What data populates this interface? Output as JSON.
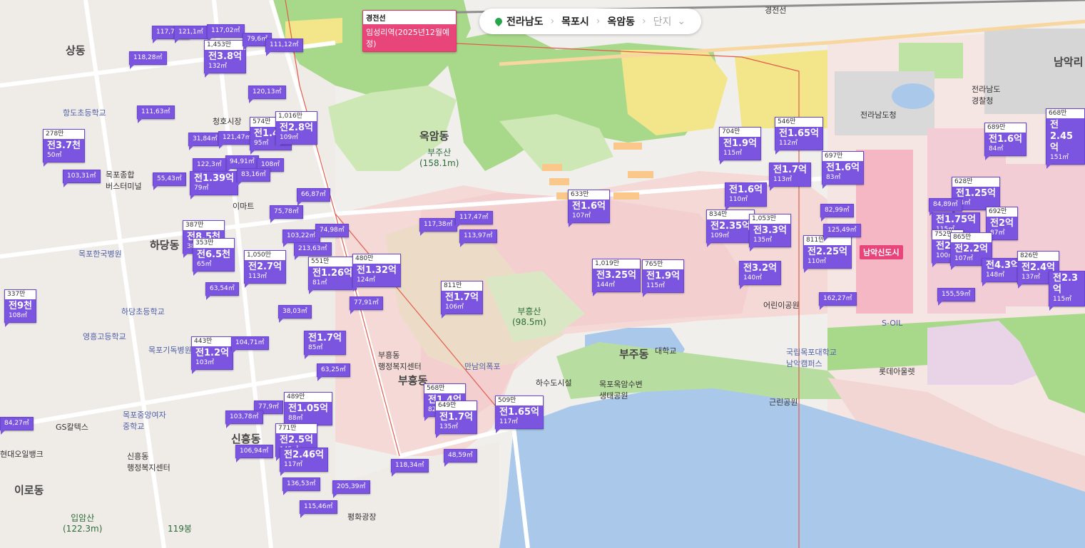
{
  "breadcrumb": {
    "province": "전라남도",
    "city": "목포시",
    "district": "옥암동",
    "level": "단지"
  },
  "station_tag": {
    "line": "경전선",
    "name": "임성리역(2025년12월예정)"
  },
  "new_town_pin": "남악신도시",
  "map_labels": [
    {
      "id": "sangdong",
      "text": "상동",
      "cls": "big"
    },
    {
      "id": "hadangdong",
      "text": "하당동",
      "cls": "big"
    },
    {
      "id": "okamdong",
      "text": "옥암동",
      "cls": "big"
    },
    {
      "id": "bujudong",
      "text": "부주동",
      "cls": "big"
    },
    {
      "id": "sinheungdong",
      "text": "신흥동",
      "cls": "big"
    },
    {
      "id": "irodong",
      "text": "이로동",
      "cls": "big"
    },
    {
      "id": "namak",
      "text": "남악리",
      "cls": "big"
    },
    {
      "id": "bubheungdong",
      "text": "부흥동",
      "cls": "big"
    },
    {
      "id": "busan",
      "text": "부주산\n(158.1m)",
      "cls": "mtn"
    },
    {
      "id": "buheungsan",
      "text": "부흥산\n(98.5m)",
      "cls": "mtn"
    },
    {
      "id": "ipamsan",
      "text": "입암산\n(122.3m)",
      "cls": "mtn"
    },
    {
      "id": "bong119",
      "text": "119봉",
      "cls": "mtn"
    },
    {
      "id": "hangdo",
      "text": "항도초등학교",
      "cls": "poi"
    },
    {
      "id": "hadang_school",
      "text": "하당초등학교",
      "cls": "poi"
    },
    {
      "id": "yeongheung",
      "text": "영흥고등학교",
      "cls": "poi"
    },
    {
      "id": "mokpo_jungang",
      "text": "목포중앙여자\n중학교",
      "cls": "poi"
    },
    {
      "id": "mokpo_hospital",
      "text": "목포한국병원",
      "cls": "poi"
    },
    {
      "id": "mokpo_christian",
      "text": "목포기독병원",
      "cls": "poi"
    },
    {
      "id": "terminal",
      "text": "목포종합\n버스터미널",
      "cls": "zone"
    },
    {
      "id": "cheongho",
      "text": "청호시장",
      "cls": "zone"
    },
    {
      "id": "emart",
      "text": "이마트",
      "cls": "zone"
    },
    {
      "id": "gs",
      "text": "GS칼텍스",
      "cls": "zone"
    },
    {
      "id": "hyundai_oil",
      "text": "현대오일뱅크",
      "cls": "zone"
    },
    {
      "id": "sinheung_center",
      "text": "신흥동\n행정복지센터",
      "cls": "zone"
    },
    {
      "id": "buheung_center",
      "text": "부흥동\n행정복지센터",
      "cls": "zone"
    },
    {
      "id": "manin",
      "text": "만남의폭포",
      "cls": "poi"
    },
    {
      "id": "pyeonghwa",
      "text": "평화광장",
      "cls": "zone"
    },
    {
      "id": "eco_park",
      "text": "목포옥암수변\n생태공원",
      "cls": "zone"
    },
    {
      "id": "mokpo_univ",
      "text": "국립목포대학교\n남악캠퍼스",
      "cls": "poi"
    },
    {
      "id": "jeonnam_police",
      "text": "전라남도\n경찰청",
      "cls": "zone"
    },
    {
      "id": "jeonnam_office",
      "text": "전라남도청",
      "cls": "zone"
    },
    {
      "id": "lotte",
      "text": "롯데아울렛",
      "cls": "zone"
    },
    {
      "id": "soil",
      "text": "S-OIL",
      "cls": "poi"
    },
    {
      "id": "eorin_park",
      "text": "어린이공원",
      "cls": "zone"
    },
    {
      "id": "geunlin_park",
      "text": "근린공원",
      "cls": "zone"
    },
    {
      "id": "hasudo",
      "text": "하수도시설",
      "cls": "zone"
    },
    {
      "id": "daehakgyo",
      "text": "대학교",
      "cls": "zone"
    },
    {
      "id": "gyeongjeonseon",
      "text": "경전선",
      "cls": "zone"
    }
  ],
  "markers": [
    {
      "id": "m01",
      "top": "",
      "price": "",
      "area": "117,72㎡"
    },
    {
      "id": "m02",
      "top": "",
      "price": "",
      "area": "121,1㎡"
    },
    {
      "id": "m03",
      "top": "",
      "price": "",
      "area": "117,02㎡"
    },
    {
      "id": "m04",
      "top": "1,453만",
      "price": "전3.8억",
      "area": "132㎡"
    },
    {
      "id": "m05",
      "top": "",
      "price": "",
      "area": "79,6㎡"
    },
    {
      "id": "m06",
      "top": "",
      "price": "",
      "area": "111,12㎡"
    },
    {
      "id": "m07",
      "top": "",
      "price": "",
      "area": "118,28㎡"
    },
    {
      "id": "m08",
      "top": "",
      "price": "",
      "area": "120,13㎡"
    },
    {
      "id": "m09",
      "top": "",
      "price": "",
      "area": "111,63㎡"
    },
    {
      "id": "m10",
      "top": "278만",
      "price": "전3.7천",
      "area": "50㎡"
    },
    {
      "id": "m11",
      "top": "",
      "price": "",
      "area": "103,31㎡"
    },
    {
      "id": "m12",
      "top": "",
      "price": "",
      "area": "31,84㎡"
    },
    {
      "id": "m13",
      "top": "",
      "price": "",
      "area": "121,47㎡"
    },
    {
      "id": "m14",
      "top": "574만",
      "price": "전1.4억",
      "area": "95㎡"
    },
    {
      "id": "m15",
      "top": "1,016만",
      "price": "전2.8억",
      "area": "109㎡"
    },
    {
      "id": "m16",
      "top": "",
      "price": "",
      "area": "94,91㎡"
    },
    {
      "id": "m17",
      "top": "",
      "price": "",
      "area": "108㎡"
    },
    {
      "id": "m18",
      "top": "",
      "price": "",
      "area": "122,3㎡"
    },
    {
      "id": "m19",
      "top": "",
      "price": "전1.39억",
      "area": "79㎡"
    },
    {
      "id": "m20",
      "top": "",
      "price": "",
      "area": "83,16㎡"
    },
    {
      "id": "m21",
      "top": "",
      "price": "",
      "area": "55,43㎡"
    },
    {
      "id": "m22",
      "top": "",
      "price": "",
      "area": "66,87㎡"
    },
    {
      "id": "m23",
      "top": "",
      "price": "",
      "area": "75,78㎡"
    },
    {
      "id": "m24",
      "top": "387만",
      "price": "전8.5천",
      "area": "38㎡"
    },
    {
      "id": "m25",
      "top": "353만",
      "price": "전6.5천",
      "area": "65㎡"
    },
    {
      "id": "m26",
      "top": "",
      "price": "",
      "area": "103,22㎡"
    },
    {
      "id": "m27",
      "top": "",
      "price": "",
      "area": "74,98㎡"
    },
    {
      "id": "m28",
      "top": "",
      "price": "",
      "area": "213,63㎡"
    },
    {
      "id": "m29",
      "top": "",
      "price": "",
      "area": "117,38㎡"
    },
    {
      "id": "m30",
      "top": "",
      "price": "",
      "area": "117,47㎡"
    },
    {
      "id": "m31",
      "top": "",
      "price": "",
      "area": "113,97㎡"
    },
    {
      "id": "m32",
      "top": "1,050만",
      "price": "전2.7억",
      "area": "113㎡"
    },
    {
      "id": "m33",
      "top": "551만",
      "price": "전1.26억",
      "area": "81㎡"
    },
    {
      "id": "m34",
      "top": "480만",
      "price": "전1.32억",
      "area": "124㎡"
    },
    {
      "id": "m35",
      "top": "",
      "price": "",
      "area": "63,54㎡"
    },
    {
      "id": "m36",
      "top": "337만",
      "price": "전9천",
      "area": "108㎡"
    },
    {
      "id": "m37",
      "top": "",
      "price": "",
      "area": "38,03㎡"
    },
    {
      "id": "m38",
      "top": "",
      "price": "",
      "area": "77,91㎡"
    },
    {
      "id": "m39",
      "top": "811만",
      "price": "전1.7억",
      "area": "106㎡"
    },
    {
      "id": "m40",
      "top": "443만",
      "price": "전1.2억",
      "area": "103㎡"
    },
    {
      "id": "m41",
      "top": "",
      "price": "",
      "area": "104,71㎡"
    },
    {
      "id": "m42",
      "top": "",
      "price": "전1.7억",
      "area": "85㎡"
    },
    {
      "id": "m43",
      "top": "",
      "price": "",
      "area": "63,25㎡"
    },
    {
      "id": "m44",
      "top": "",
      "price": "",
      "area": "84,27㎡"
    },
    {
      "id": "m45",
      "top": "",
      "price": "",
      "area": "77,9㎡"
    },
    {
      "id": "m46",
      "top": "",
      "price": "",
      "area": "103,78㎡"
    },
    {
      "id": "m47",
      "top": "489만",
      "price": "전1.05억",
      "area": "88㎡"
    },
    {
      "id": "m48",
      "top": "771만",
      "price": "전2.5억",
      "area": "145㎡"
    },
    {
      "id": "m49",
      "top": "",
      "price": "전2.46억",
      "area": "117㎡"
    },
    {
      "id": "m50",
      "top": "",
      "price": "",
      "area": "106,94㎡"
    },
    {
      "id": "m51",
      "top": "",
      "price": "",
      "area": "136,53㎡"
    },
    {
      "id": "m52",
      "top": "",
      "price": "",
      "area": "205,39㎡"
    },
    {
      "id": "m53",
      "top": "",
      "price": "",
      "area": "115,46㎡"
    },
    {
      "id": "m54",
      "top": "568만",
      "price": "전1.4억",
      "area": "82㎡"
    },
    {
      "id": "m55",
      "top": "649만",
      "price": "전1.7억",
      "area": "135㎡"
    },
    {
      "id": "m56",
      "top": "",
      "price": "",
      "area": "118,34㎡"
    },
    {
      "id": "m57",
      "top": "",
      "price": "",
      "area": "48,59㎡"
    },
    {
      "id": "m58",
      "top": "509만",
      "price": "전1.65억",
      "area": "117㎡"
    },
    {
      "id": "m59",
      "top": "633만",
      "price": "전1.6억",
      "area": "107㎡"
    },
    {
      "id": "m60",
      "top": "1,019만",
      "price": "전3.25억",
      "area": "144㎡"
    },
    {
      "id": "m61",
      "top": "765만",
      "price": "전1.9억",
      "area": "115㎡"
    },
    {
      "id": "m62",
      "top": "704만",
      "price": "전1.9억",
      "area": "115㎡"
    },
    {
      "id": "m63",
      "top": "546만",
      "price": "전1.65억",
      "area": "112㎡"
    },
    {
      "id": "m64",
      "top": "",
      "price": "전1.7억",
      "area": "113㎡"
    },
    {
      "id": "m65",
      "top": "697만",
      "price": "전1.6억",
      "area": "83㎡"
    },
    {
      "id": "m66",
      "top": "",
      "price": "전1.6억",
      "area": "110㎡"
    },
    {
      "id": "m67",
      "top": "834만",
      "price": "전2.35억",
      "area": "109㎡"
    },
    {
      "id": "m68",
      "top": "1,053만",
      "price": "전3.3억",
      "area": "135㎡"
    },
    {
      "id": "m69",
      "top": "811만",
      "price": "전2.25억",
      "area": "110㎡"
    },
    {
      "id": "m70",
      "top": "",
      "price": "전3.2억",
      "area": "140㎡"
    },
    {
      "id": "m71",
      "top": "",
      "price": "",
      "area": "82,99㎡"
    },
    {
      "id": "m72",
      "top": "",
      "price": "",
      "area": "125,49㎡"
    },
    {
      "id": "m73",
      "top": "",
      "price": "",
      "area": "162,27㎡"
    },
    {
      "id": "m74",
      "top": "689만",
      "price": "전1.6억",
      "area": "84㎡"
    },
    {
      "id": "m75",
      "top": "668만",
      "price": "전2.45억",
      "area": "151㎡"
    },
    {
      "id": "m76",
      "top": "628만",
      "price": "전1.25억",
      "area": "84㎡"
    },
    {
      "id": "m77",
      "top": "",
      "price": "",
      "area": "84,89㎡"
    },
    {
      "id": "m78",
      "top": "",
      "price": "전1.75억",
      "area": "115㎡"
    },
    {
      "id": "m79",
      "top": "692만",
      "price": "전2억",
      "area": "87㎡"
    },
    {
      "id": "m80",
      "top": "752만",
      "price": "전2억",
      "area": "100㎡"
    },
    {
      "id": "m81",
      "top": "865만",
      "price": "전2.2억",
      "area": "107㎡"
    },
    {
      "id": "m82",
      "top": "",
      "price": "전4.3억",
      "area": "148㎡"
    },
    {
      "id": "m83",
      "top": "826만",
      "price": "전2.4억",
      "area": "137㎡"
    },
    {
      "id": "m84",
      "top": "",
      "price": "전2.3억",
      "area": "115㎡"
    },
    {
      "id": "m85",
      "top": "",
      "price": "",
      "area": "155,59㎡"
    }
  ],
  "colors": {
    "marker": "#7b55e0",
    "water": "#a9c8ea",
    "green": "#a8d98a",
    "residential_yellow": "#f3e58a",
    "commercial_pink": "#f4a6b8",
    "pin": "#e8457a"
  }
}
